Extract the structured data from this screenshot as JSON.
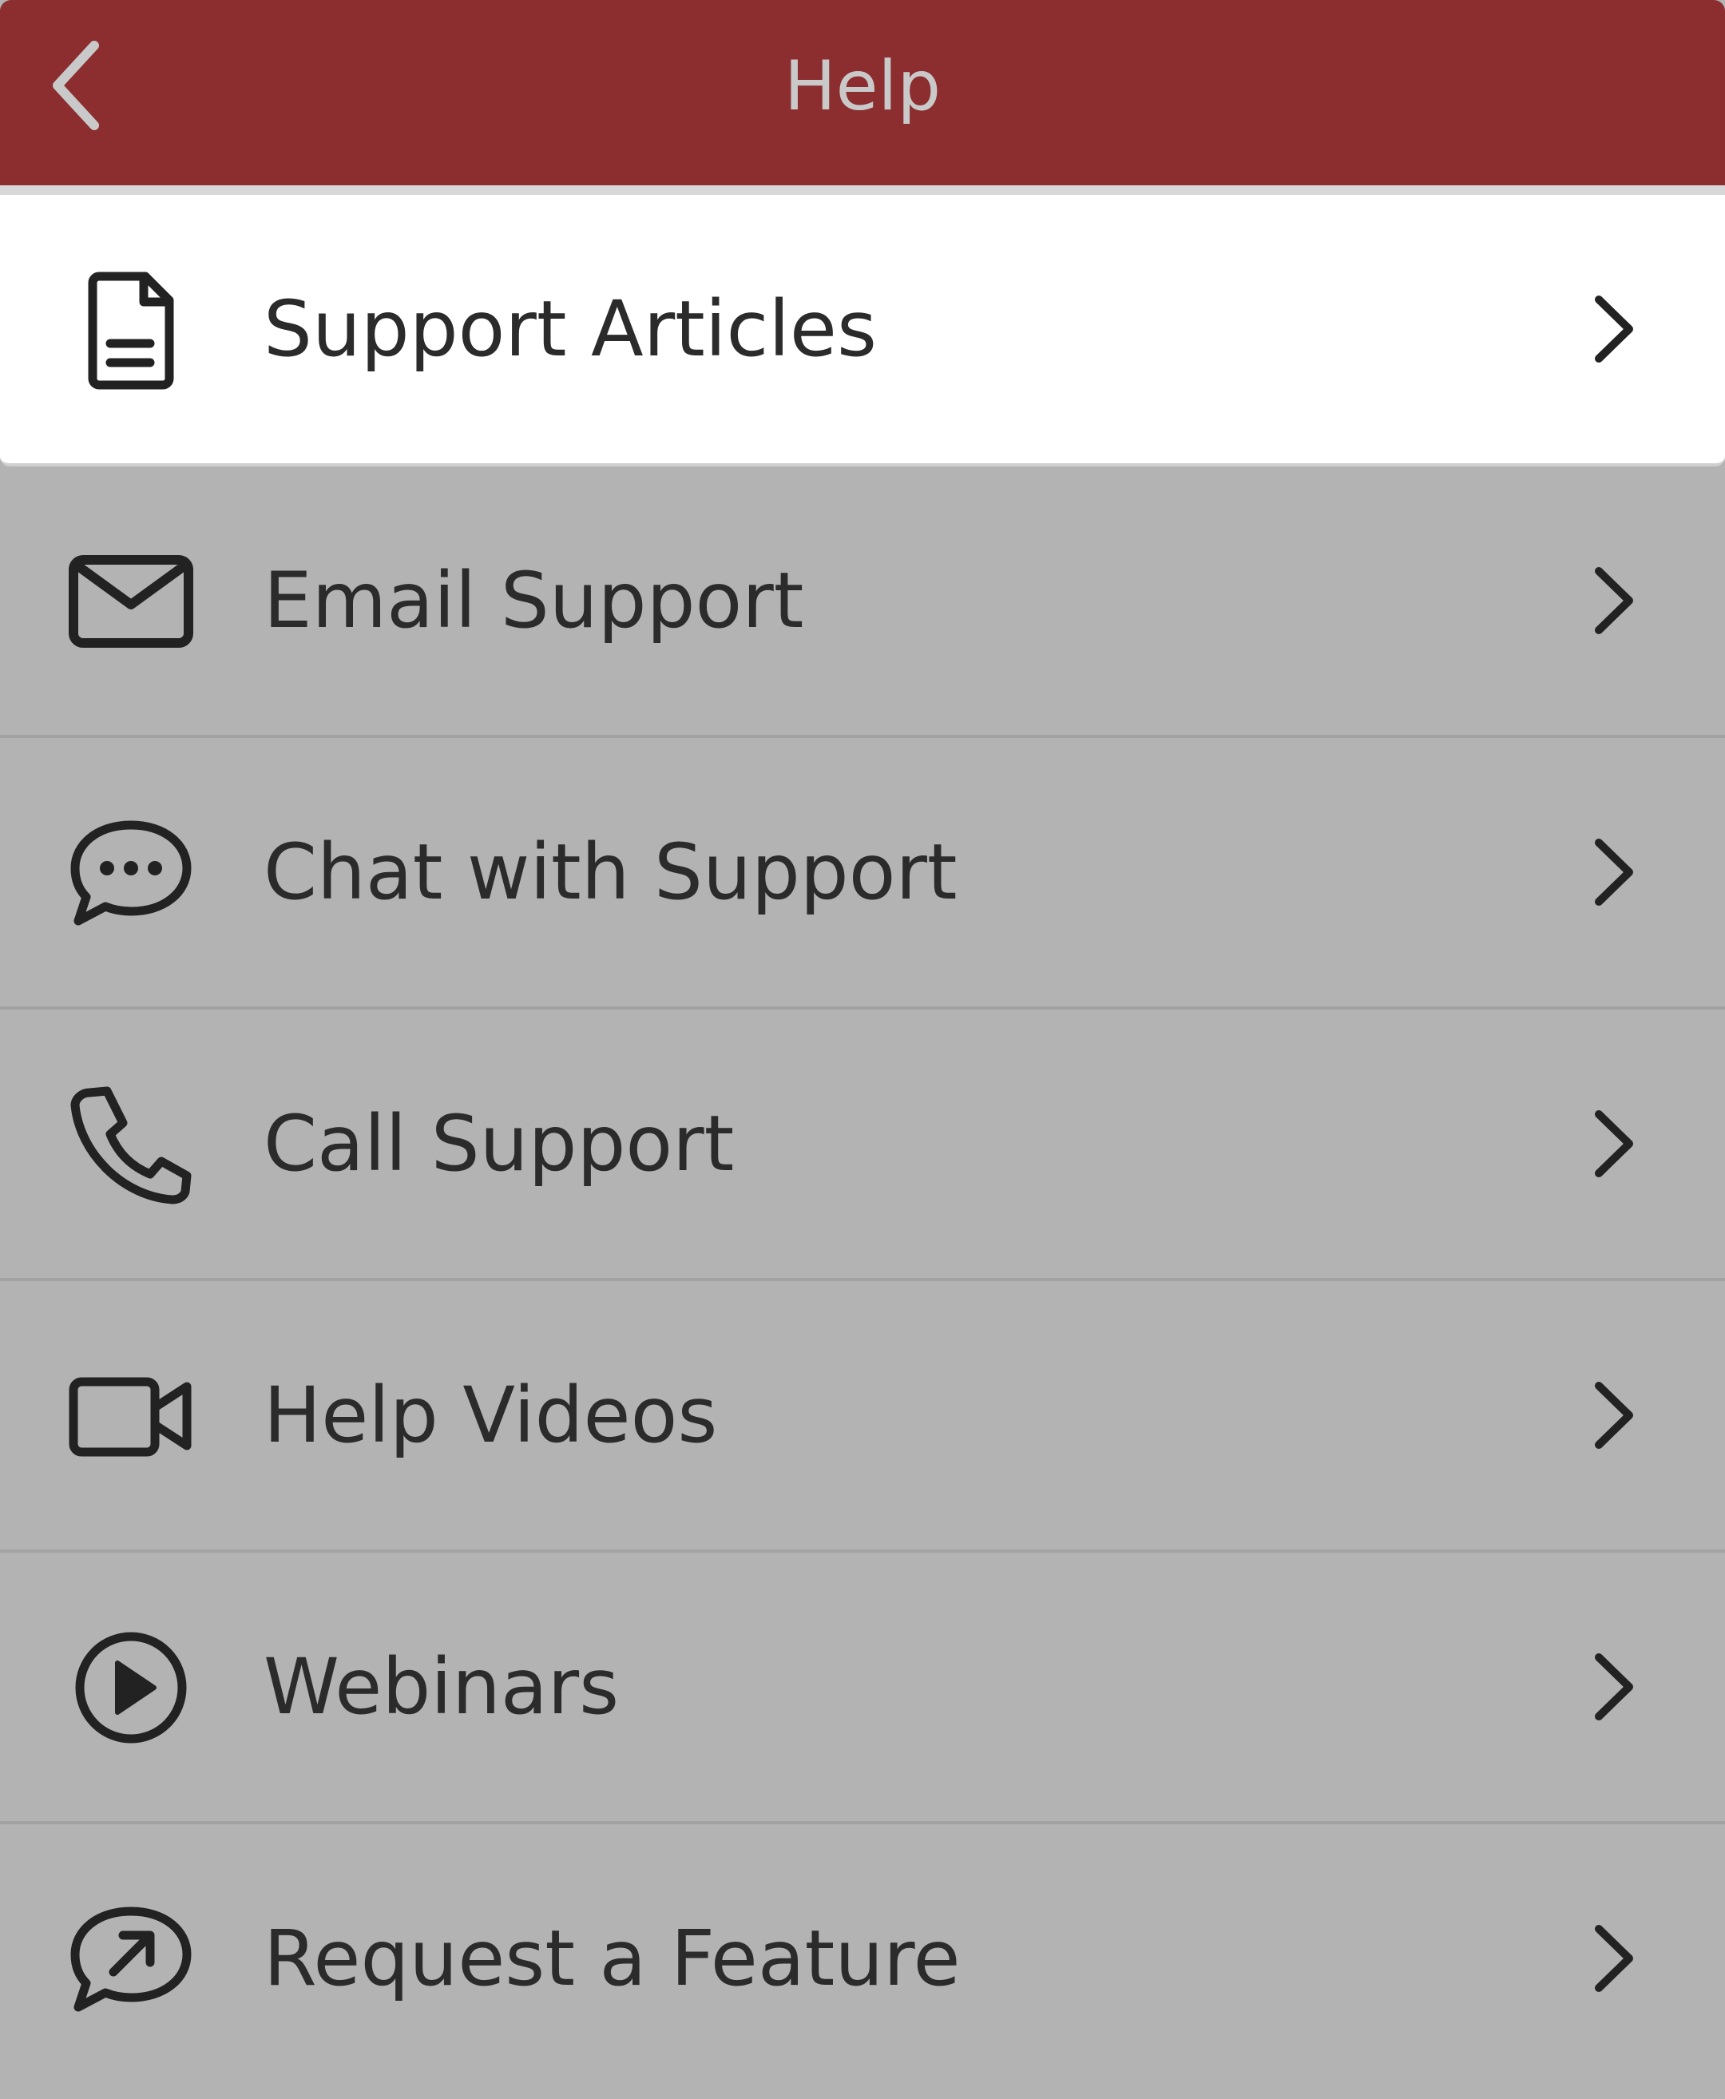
{
  "header": {
    "title": "Help",
    "back_icon": "chevron-left-icon",
    "background": "#8c2d2f",
    "title_color": "#c9c9c9"
  },
  "menu": {
    "items": [
      {
        "label": "Support Articles",
        "icon": "document-icon",
        "selected": true
      },
      {
        "label": "Email Support",
        "icon": "envelope-icon",
        "selected": false
      },
      {
        "label": "Chat with Support",
        "icon": "chat-bubble-icon",
        "selected": false
      },
      {
        "label": "Call Support",
        "icon": "phone-icon",
        "selected": false
      },
      {
        "label": "Help Videos",
        "icon": "video-camera-icon",
        "selected": false
      },
      {
        "label": "Webinars",
        "icon": "play-circle-icon",
        "selected": false
      },
      {
        "label": "Request a Feature",
        "icon": "feature-request-icon",
        "selected": false
      }
    ]
  },
  "colors": {
    "overlay_gray": "#b3b3b3",
    "selected_row": "#ffffff",
    "text": "#2b2b2b"
  }
}
